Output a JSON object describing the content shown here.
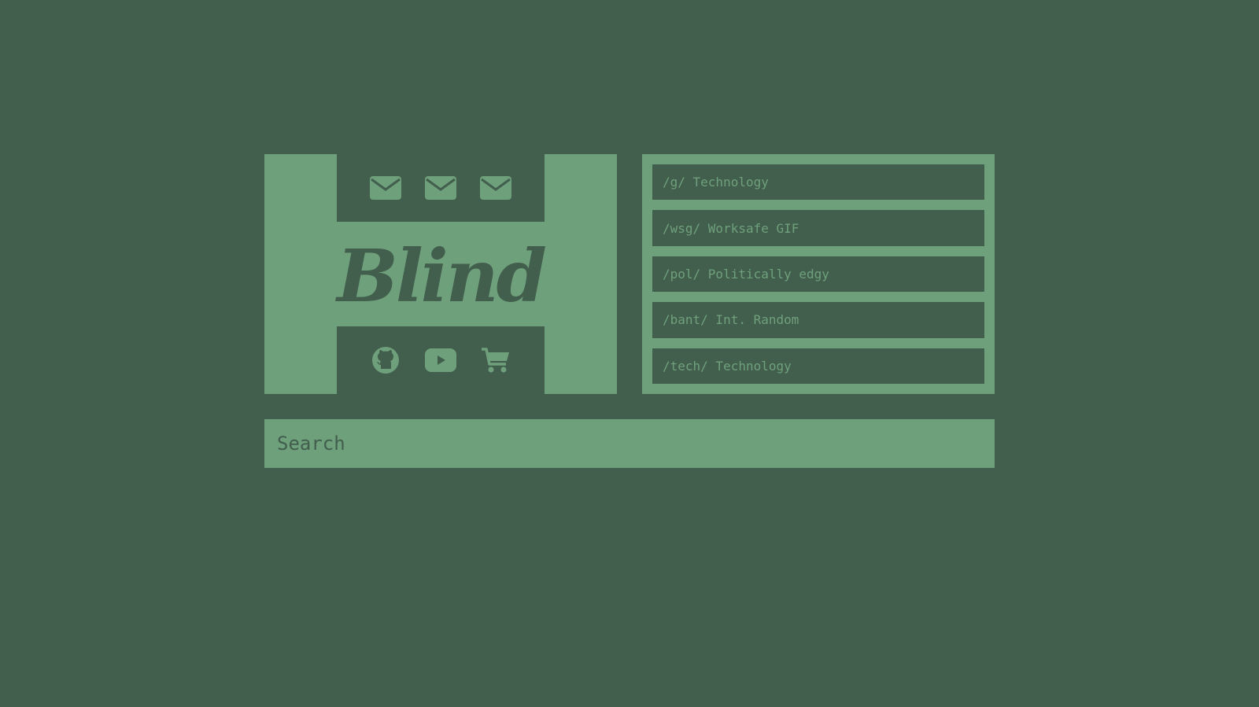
{
  "brand": {
    "logo_text": "Blind",
    "top_icons": [
      "envelope-icon",
      "envelope-icon",
      "envelope-icon"
    ],
    "bottom_icons": [
      "github-icon",
      "youtube-icon",
      "cart-icon"
    ]
  },
  "boards": [
    {
      "label": "/g/ Technology"
    },
    {
      "label": "/wsg/ Worksafe GIF"
    },
    {
      "label": "/pol/ Politically edgy"
    },
    {
      "label": "/bant/ Int. Random"
    },
    {
      "label": "/tech/ Technology"
    }
  ],
  "search": {
    "placeholder": "Search",
    "value": ""
  },
  "colors": {
    "background": "#425e4d",
    "accent": "#6fa07c"
  }
}
